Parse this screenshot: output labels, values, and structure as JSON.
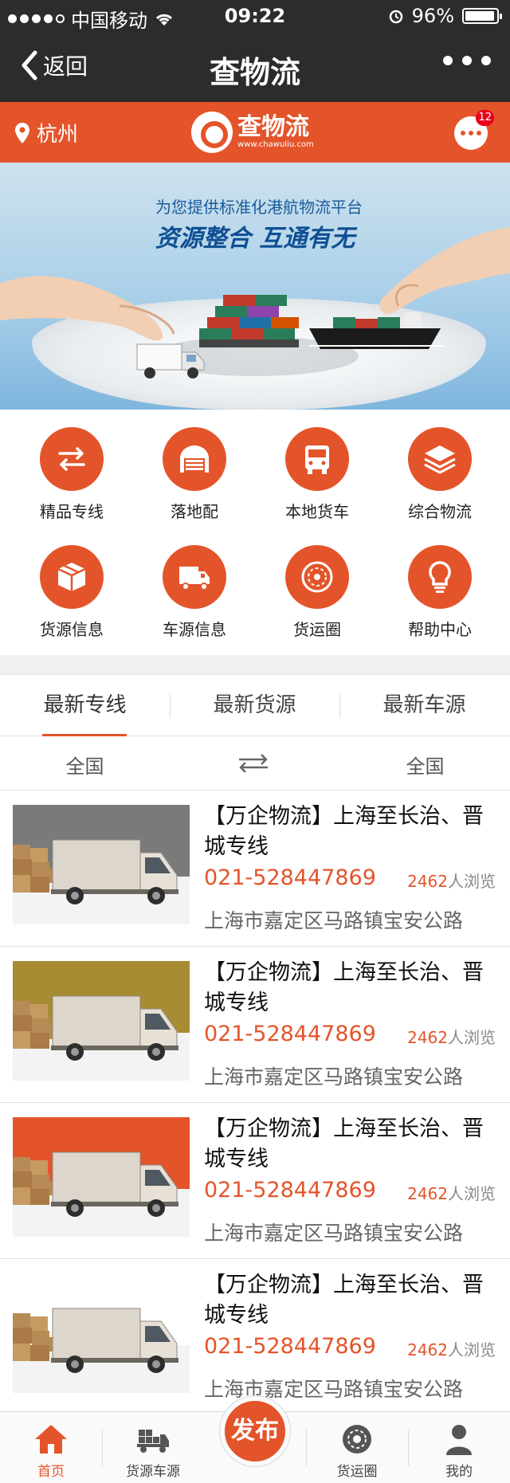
{
  "status_bar": {
    "carrier": "中国移动",
    "time": "09:22",
    "battery": "96%"
  },
  "nav": {
    "back_label": "返回",
    "title": "查物流"
  },
  "header": {
    "city": "杭州",
    "logo_text": "查物流",
    "logo_url": "www.chawuliu.com",
    "message_badge": "12"
  },
  "banner": {
    "subtitle": "为您提供标准化港航物流平台",
    "headline": "资源整合 互通有无"
  },
  "grid": [
    {
      "label": "精品专线",
      "icon": "swap-arrows-icon"
    },
    {
      "label": "落地配",
      "icon": "garage-icon"
    },
    {
      "label": "本地货车",
      "icon": "truck-front-icon"
    },
    {
      "label": "综合物流",
      "icon": "layers-icon"
    },
    {
      "label": "货源信息",
      "icon": "package-icon"
    },
    {
      "label": "车源信息",
      "icon": "truck-icon"
    },
    {
      "label": "货运圈",
      "icon": "disc-icon"
    },
    {
      "label": "帮助中心",
      "icon": "bulb-icon"
    }
  ],
  "tabs": [
    "最新专线",
    "最新货源",
    "最新车源"
  ],
  "route": {
    "from": "全国",
    "to": "全国"
  },
  "listings": [
    {
      "title": "【万企物流】上海至长治、晋城专线",
      "phone": "021-528447869",
      "views_count": "2462",
      "views_suffix": "人浏览",
      "address": "上海市嘉定区马路镇宝安公路",
      "bg": "#7a7a7a"
    },
    {
      "title": "【万企物流】上海至长治、晋城专线",
      "phone": "021-528447869",
      "views_count": "2462",
      "views_suffix": "人浏览",
      "address": "上海市嘉定区马路镇宝安公路",
      "bg": "#a88c34"
    },
    {
      "title": "【万企物流】上海至长治、晋城专线",
      "phone": "021-528447869",
      "views_count": "2462",
      "views_suffix": "人浏览",
      "address": "上海市嘉定区马路镇宝安公路",
      "bg": "#e4542a"
    },
    {
      "title": "【万企物流】上海至长治、晋城专线",
      "phone": "021-528447869",
      "views_count": "2462",
      "views_suffix": "人浏览",
      "address": "上海市嘉定区马路镇宝安公路",
      "bg": "#ffffff"
    }
  ],
  "bottom_tabs": [
    {
      "label": "首页",
      "icon": "home-icon",
      "active": true
    },
    {
      "label": "货源车源",
      "icon": "cargo-truck-icon",
      "active": false
    },
    {
      "label": "货运圈",
      "icon": "disc-icon",
      "active": false
    },
    {
      "label": "我的",
      "icon": "user-icon",
      "active": false
    }
  ],
  "publish_label": "发布",
  "colors": {
    "accent": "#e4542a",
    "nav_bg": "#2c2c2c"
  }
}
